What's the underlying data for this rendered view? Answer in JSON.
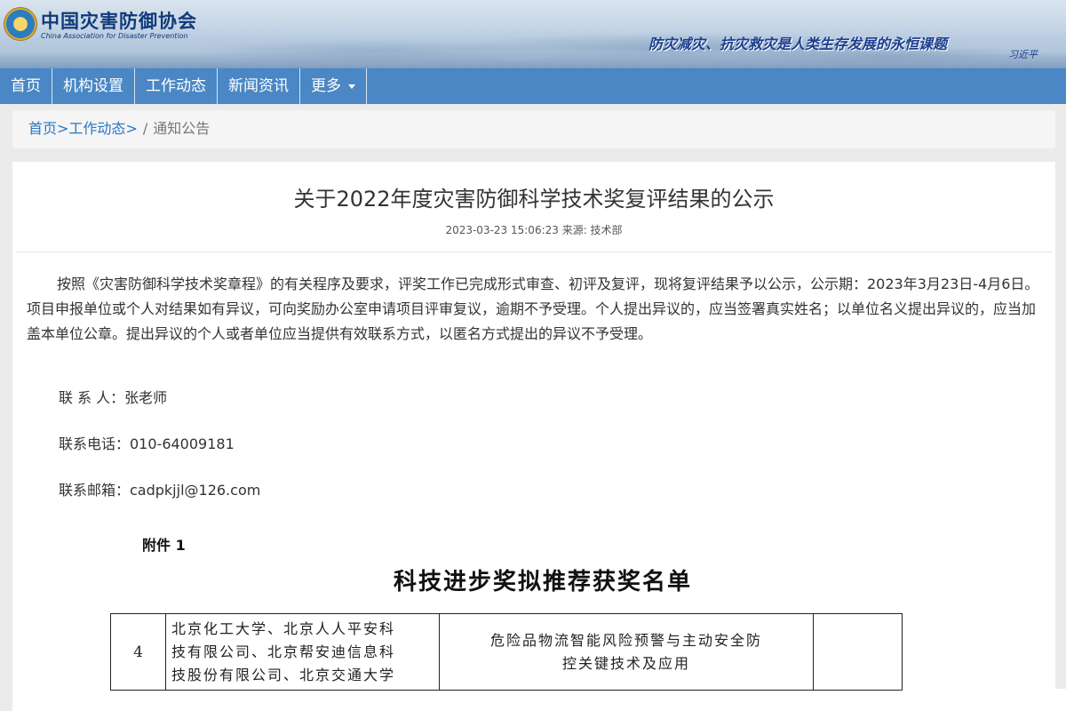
{
  "header": {
    "logo_cn": "中国灾害防御协会",
    "logo_en": "China Association for Disaster Prevention",
    "slogan": "防灾减灾、抗灾救灾是人类生存发展的永恒课题",
    "slogan_sig": "习近平"
  },
  "nav": {
    "items": [
      {
        "label": "首页"
      },
      {
        "label": "机构设置"
      },
      {
        "label": "工作动态"
      },
      {
        "label": "新闻资讯"
      },
      {
        "label": "更多"
      }
    ]
  },
  "breadcrumb": {
    "home": "首页",
    "section": "工作动态",
    "arrow1": ">",
    "arrow2": ">",
    "sep": "/",
    "current": "通知公告"
  },
  "article": {
    "title": "关于2022年度灾害防御科学技术奖复评结果的公示",
    "meta": "2023-03-23 15:06:23 来源: 技术部",
    "body": "按照《灾害防御科学技术奖章程》的有关程序及要求，评奖工作已完成形式审查、初评及复评，现将复评结果予以公示，公示期：2023年3月23日-4月6日。项目申报单位或个人对结果如有异议，可向奖励办公室申请项目评审复议，逾期不予受理。个人提出异议的，应当签署真实姓名；以单位名义提出异议的，应当加盖本单位公章。提出异议的个人或者单位应当提供有效联系方式，以匿名方式提出的异议不予受理。",
    "contact_person": "联 系 人：张老师",
    "contact_phone": "联系电话：010-64009181",
    "contact_email": "联系邮箱：cadpkjjl@126.com"
  },
  "attachment": {
    "label": "附件 1",
    "title": "科技进步奖拟推荐获奖名单",
    "rows": [
      {
        "no": "4",
        "unit_lines": [
          "北京化工大学、北京人人平安科",
          "技有限公司、北京帮安迪信息科",
          "技股份有限公司、北京交通大学"
        ],
        "project_lines": [
          "危险品物流智能风险预警与主动安全防",
          "控关键技术及应用"
        ]
      }
    ]
  }
}
